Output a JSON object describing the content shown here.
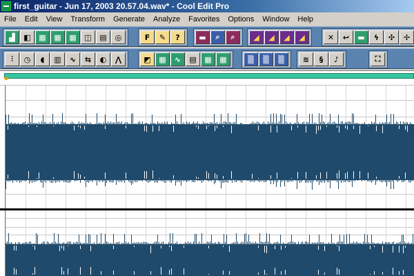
{
  "window": {
    "title": "first_guitar - Jun 17, 2003 20.57.04.wav* - Cool Edit Pro"
  },
  "menu": [
    "File",
    "Edit",
    "View",
    "Transform",
    "Generate",
    "Analyze",
    "Favorites",
    "Options",
    "Window",
    "Help"
  ],
  "toolbar1": {
    "groups": [
      {
        "name": "display-group",
        "buttons": [
          {
            "id": "waveform-view",
            "glyph": "▟",
            "style": "green"
          },
          {
            "id": "open-file",
            "glyph": "◧",
            "style": ""
          },
          {
            "id": "tile-view",
            "glyph": "▦",
            "style": "green"
          },
          {
            "id": "multitrack",
            "glyph": "▦",
            "style": "green"
          },
          {
            "id": "spectral-view",
            "glyph": "▦",
            "style": "green"
          },
          {
            "id": "doc",
            "glyph": "◫",
            "style": ""
          },
          {
            "id": "page",
            "glyph": "▤",
            "style": ""
          },
          {
            "id": "cd",
            "glyph": "◎",
            "style": ""
          }
        ]
      },
      {
        "name": "favorites-group",
        "buttons": [
          {
            "id": "font",
            "glyph": "F",
            "style": "yellow"
          },
          {
            "id": "script",
            "glyph": "✎",
            "style": "yellow"
          },
          {
            "id": "help",
            "glyph": "?",
            "style": "yellow"
          }
        ]
      },
      {
        "name": "zoom-group",
        "buttons": [
          {
            "id": "zoom-fit",
            "glyph": "▬",
            "style": "maroon"
          },
          {
            "id": "zoom-in",
            "glyph": "⌕",
            "style": "blue"
          },
          {
            "id": "zoom-out",
            "glyph": "⌕",
            "style": "maroon"
          }
        ]
      },
      {
        "name": "effects-group",
        "buttons": [
          {
            "id": "fx-1",
            "glyph": "◢",
            "style": "purple"
          },
          {
            "id": "fx-2",
            "glyph": "◢",
            "style": "purple"
          },
          {
            "id": "fx-3",
            "glyph": "◢",
            "style": "purple"
          },
          {
            "id": "fx-4",
            "glyph": "◢",
            "style": "purple"
          }
        ]
      },
      {
        "name": "tools-group",
        "buttons": [
          {
            "id": "tool-1",
            "glyph": "✕",
            "style": ""
          },
          {
            "id": "tool-2",
            "glyph": "↩",
            "style": ""
          },
          {
            "id": "tool-3",
            "glyph": "▬",
            "style": "green"
          },
          {
            "id": "tool-4",
            "glyph": "ϟ",
            "style": ""
          },
          {
            "id": "tool-5",
            "glyph": "✣",
            "style": ""
          },
          {
            "id": "tool-6",
            "glyph": "✢",
            "style": ""
          }
        ]
      }
    ]
  },
  "toolbar2": {
    "groups": [
      {
        "name": "transform-group",
        "buttons": [
          {
            "id": "t-1",
            "glyph": "⫶",
            "style": ""
          },
          {
            "id": "t-2",
            "glyph": "◷",
            "style": ""
          },
          {
            "id": "t-3",
            "glyph": "◖",
            "style": ""
          },
          {
            "id": "t-4",
            "glyph": "▥",
            "style": ""
          },
          {
            "id": "t-5",
            "glyph": "∿",
            "style": ""
          },
          {
            "id": "t-6",
            "glyph": "⇆",
            "style": ""
          },
          {
            "id": "t-7",
            "glyph": "◐",
            "style": ""
          },
          {
            "id": "t-8",
            "glyph": "⋀",
            "style": ""
          }
        ]
      },
      {
        "name": "analyze-group",
        "buttons": [
          {
            "id": "a-1",
            "glyph": "◩",
            "style": "yellow"
          },
          {
            "id": "a-2",
            "glyph": "▦",
            "style": "green"
          },
          {
            "id": "a-3",
            "glyph": "∿",
            "style": "green"
          },
          {
            "id": "a-4",
            "glyph": "▤",
            "style": ""
          },
          {
            "id": "a-5",
            "glyph": "▦",
            "style": "green"
          },
          {
            "id": "a-6",
            "glyph": "▦",
            "style": "green"
          }
        ]
      },
      {
        "name": "noise-group",
        "buttons": [
          {
            "id": "n-1",
            "glyph": "▒",
            "style": "blue"
          },
          {
            "id": "n-2",
            "glyph": "▒",
            "style": "blue"
          },
          {
            "id": "n-3",
            "glyph": "▒",
            "style": "blue"
          }
        ]
      },
      {
        "name": "generate-group",
        "buttons": [
          {
            "id": "g-1",
            "glyph": "≋",
            "style": ""
          },
          {
            "id": "g-2",
            "glyph": "§",
            "style": ""
          },
          {
            "id": "g-3",
            "glyph": "♪",
            "style": ""
          }
        ]
      },
      {
        "name": "fullscreen-group",
        "buttons": [
          {
            "id": "f-1",
            "glyph": "⛶",
            "style": ""
          }
        ]
      }
    ]
  },
  "colors": {
    "waveform": "#1f4a6b",
    "overview": "#35c7a0",
    "toolbar": "#5a83b0"
  }
}
